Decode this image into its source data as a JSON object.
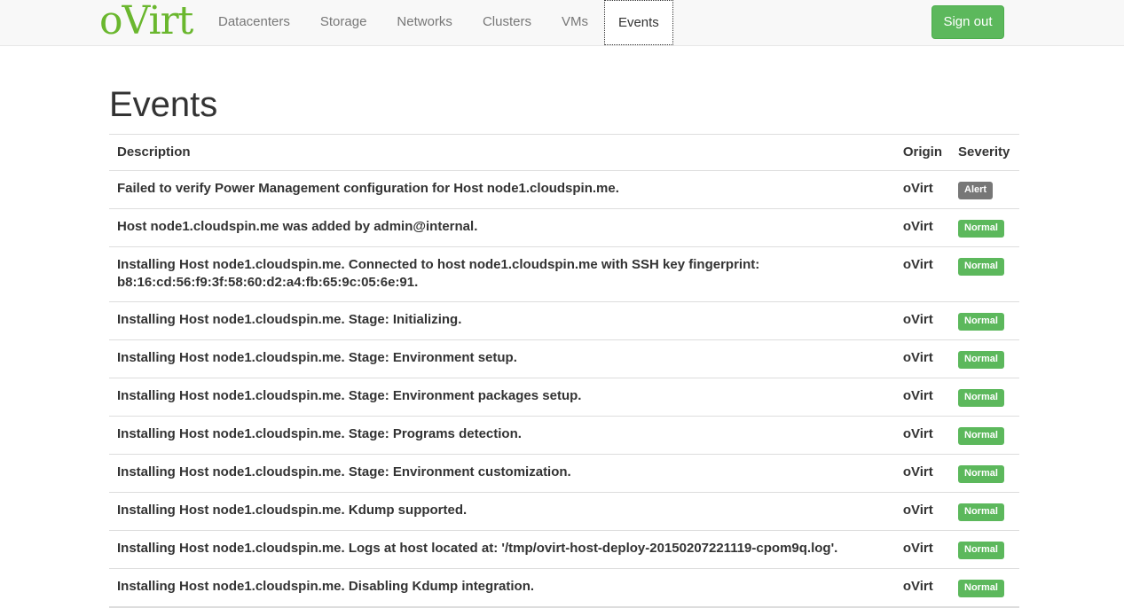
{
  "header": {
    "brand": "oVirt",
    "nav": [
      {
        "label": "Datacenters",
        "active": false
      },
      {
        "label": "Storage",
        "active": false
      },
      {
        "label": "Networks",
        "active": false
      },
      {
        "label": "Clusters",
        "active": false
      },
      {
        "label": "VMs",
        "active": false
      },
      {
        "label": "Events",
        "active": true
      }
    ],
    "signout_label": "Sign out"
  },
  "page": {
    "title": "Events"
  },
  "table": {
    "columns": [
      "Description",
      "Origin",
      "Severity"
    ],
    "rows": [
      {
        "description": "Failed to verify Power Management configuration for Host node1.cloudspin.me.",
        "origin": "oVirt",
        "severity": "Alert"
      },
      {
        "description": "Host node1.cloudspin.me was added by admin@internal.",
        "origin": "oVirt",
        "severity": "Normal"
      },
      {
        "description": "Installing Host node1.cloudspin.me. Connected to host node1.cloudspin.me with SSH key fingerprint: b8:16:cd:56:f9:3f:58:60:d2:a4:fb:65:9c:05:6e:91.",
        "origin": "oVirt",
        "severity": "Normal"
      },
      {
        "description": "Installing Host node1.cloudspin.me. Stage: Initializing.",
        "origin": "oVirt",
        "severity": "Normal"
      },
      {
        "description": "Installing Host node1.cloudspin.me. Stage: Environment setup.",
        "origin": "oVirt",
        "severity": "Normal"
      },
      {
        "description": "Installing Host node1.cloudspin.me. Stage: Environment packages setup.",
        "origin": "oVirt",
        "severity": "Normal"
      },
      {
        "description": "Installing Host node1.cloudspin.me. Stage: Programs detection.",
        "origin": "oVirt",
        "severity": "Normal"
      },
      {
        "description": "Installing Host node1.cloudspin.me. Stage: Environment customization.",
        "origin": "oVirt",
        "severity": "Normal"
      },
      {
        "description": "Installing Host node1.cloudspin.me. Kdump supported.",
        "origin": "oVirt",
        "severity": "Normal"
      },
      {
        "description": "Installing Host node1.cloudspin.me. Logs at host located at: '/tmp/ovirt-host-deploy-20150207221119-cpom9q.log'.",
        "origin": "oVirt",
        "severity": "Normal"
      },
      {
        "description": "Installing Host node1.cloudspin.me. Disabling Kdump integration.",
        "origin": "oVirt",
        "severity": "Normal"
      }
    ]
  },
  "colors": {
    "brand": "#6ab72e",
    "normal": "#5cb85c",
    "alert": "#777777"
  }
}
